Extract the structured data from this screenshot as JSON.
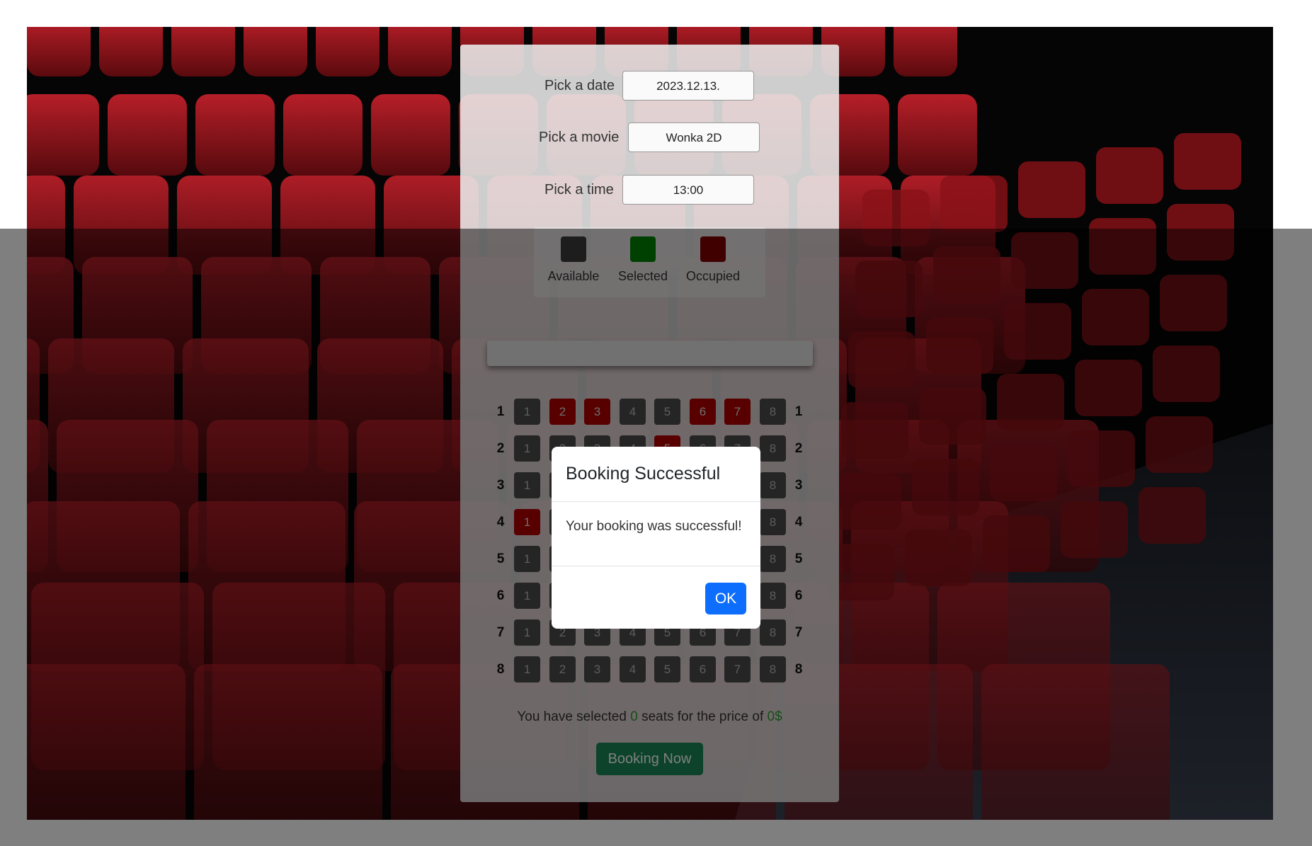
{
  "form": {
    "date_label": "Pick a date",
    "date_value": "2023.12.13.",
    "movie_label": "Pick a movie",
    "movie_value": "Wonka 2D",
    "time_label": "Pick a time",
    "time_value": "13:00"
  },
  "legend": {
    "available": "Available",
    "selected": "Selected",
    "occupied": "Occupied"
  },
  "colors": {
    "available": "#3a3a3a",
    "selected": "#008000",
    "occupied": "#800000",
    "book_button": "#198754",
    "ok_button": "#0d6efd"
  },
  "seats": {
    "row_labels": [
      "1",
      "2",
      "3",
      "4",
      "5",
      "6",
      "7",
      "8"
    ],
    "seat_numbers": [
      "1",
      "2",
      "3",
      "4",
      "5",
      "6",
      "7",
      "8"
    ],
    "occupied": [
      [
        1,
        2
      ],
      [
        1,
        3
      ],
      [
        1,
        6
      ],
      [
        1,
        7
      ],
      [
        2,
        5
      ],
      [
        4,
        1
      ]
    ]
  },
  "summary": {
    "prefix": "You have selected",
    "count": "0",
    "middle": "seats for the price of",
    "price": "0$"
  },
  "book_button": "Booking Now",
  "modal": {
    "title": "Booking Successful",
    "message": "Your booking was successful!",
    "ok_label": "OK"
  }
}
